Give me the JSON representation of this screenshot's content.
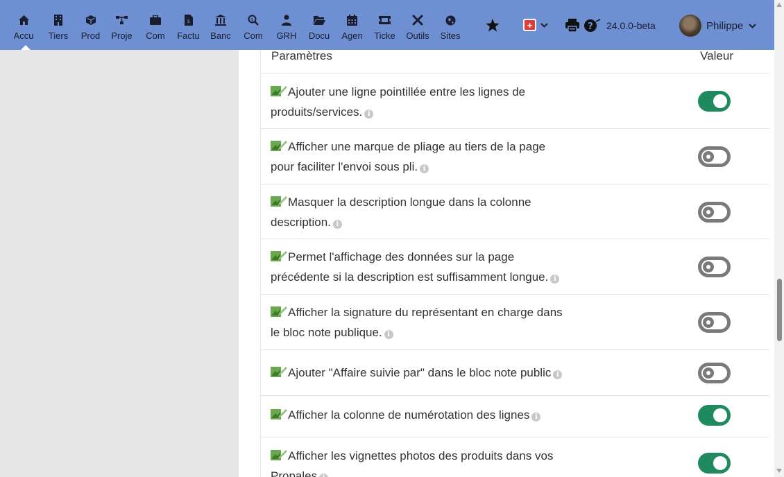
{
  "nav": {
    "items": [
      {
        "label": "Accu",
        "icon": "home-icon"
      },
      {
        "label": "Tiers",
        "icon": "building-icon"
      },
      {
        "label": "Prod",
        "icon": "cube-icon"
      },
      {
        "label": "Proje",
        "icon": "project-icon"
      },
      {
        "label": "Com",
        "icon": "briefcase-icon"
      },
      {
        "label": "Factu",
        "icon": "invoice-icon"
      },
      {
        "label": "Banc",
        "icon": "bank-icon"
      },
      {
        "label": "Com",
        "icon": "search-dollar-icon"
      },
      {
        "label": "GRH",
        "icon": "users-icon"
      },
      {
        "label": "Docu",
        "icon": "folder-icon"
      },
      {
        "label": "Agen",
        "icon": "calendar-icon"
      },
      {
        "label": "Ticke",
        "icon": "ticket-icon"
      },
      {
        "label": "Outils",
        "icon": "tools-icon"
      },
      {
        "label": "Sites",
        "icon": "globe-icon"
      }
    ]
  },
  "topbar": {
    "version": "24.0.0-beta",
    "user_name": "Philippe",
    "flag_color": "#e23b3b",
    "bar_color": "#6e8fd1"
  },
  "table": {
    "header_param": "Paramètres",
    "header_value": "Valeur",
    "rows": [
      {
        "line1": "Ajouter une ligne pointillée entre les lignes de",
        "line2": "produits/services.",
        "on": true
      },
      {
        "line1": "Afficher une marque de pliage au tiers de la page",
        "line2": "pour faciliter l'envoi sous pli.",
        "on": false
      },
      {
        "line1": "Masquer la description longue dans la colonne",
        "line2": "description.",
        "on": false
      },
      {
        "line1": "Permet l'affichage des données sur la page",
        "line2": "précédente si la description est suffisamment longue.",
        "on": false
      },
      {
        "line1": "Afficher la signature du représentant en charge dans",
        "line2": "le bloc note publique.",
        "on": false
      },
      {
        "line1": "Ajouter \"Affaire suivie par\" dans le bloc note public",
        "line2": "",
        "on": false
      },
      {
        "line1": "Afficher la colonne de numérotation des lignes",
        "line2": "",
        "on": true
      },
      {
        "line1": "Afficher les vignettes photos des produits dans vos",
        "line2": "Propales",
        "on": true
      }
    ],
    "toggle_on_color": "#1f8a5e",
    "toggle_off_color": "#7a7a7a"
  }
}
